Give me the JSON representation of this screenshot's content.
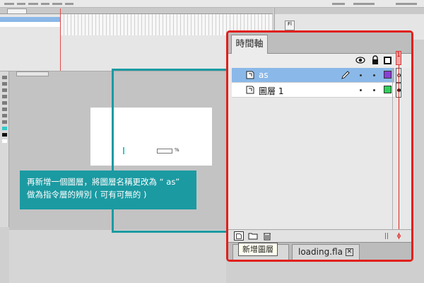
{
  "timeline_panel": {
    "tab_label": "時間軸",
    "layers": [
      {
        "name": "as",
        "selected": true,
        "color": "#8a3fd8"
      },
      {
        "name": "圖層 1",
        "selected": false,
        "color": "#2ed15a"
      }
    ],
    "frame_number": "1",
    "header_icons": [
      "eye-icon",
      "lock-icon",
      "outline-icon"
    ],
    "footer_icons": [
      "new-layer-icon",
      "new-folder-icon",
      "trash-icon"
    ],
    "bottom_tabs": {
      "file_tab": "loading.fla"
    },
    "tooltip": "新增圖層"
  },
  "annotation": {
    "line1": "再新增一個圖層，將圖層名稱更改為 “ as”",
    "line2": "做為指令層的辨別 ( 可有可無的 )"
  },
  "stage": {
    "percent_sign": "%"
  },
  "colors": {
    "highlight": "#e0201c",
    "callout": "#1b9aa2",
    "selected_row": "#8ab8e8"
  }
}
